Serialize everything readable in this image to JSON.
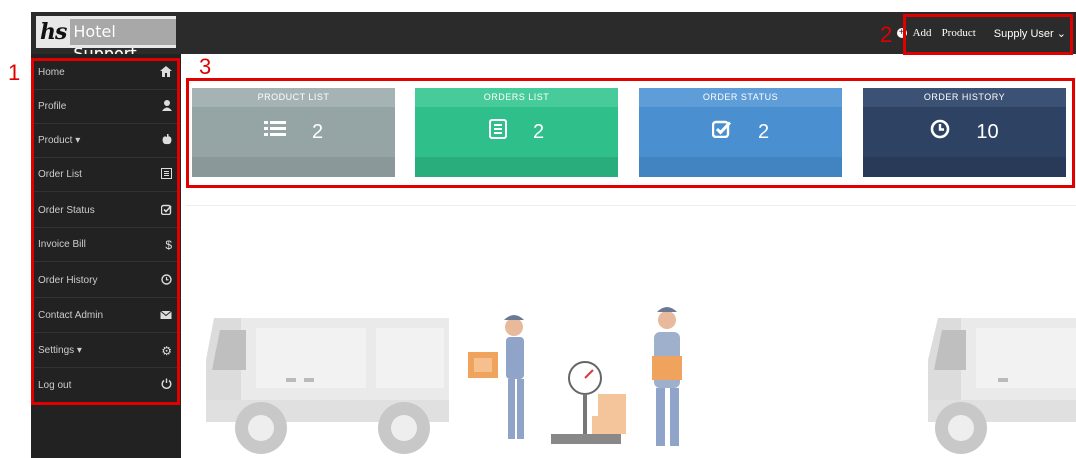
{
  "brand": {
    "logo_mark": "hs",
    "name": "Hotel Support"
  },
  "topnav": {
    "add_label": "Add",
    "product_label": "Product",
    "user_label": "Supply User",
    "user_caret": "⌄"
  },
  "sidebar": {
    "items": [
      {
        "label": "Home",
        "icon": "home-icon",
        "glyph": "🏠"
      },
      {
        "label": "Profile",
        "icon": "user-icon",
        "glyph": "👤"
      },
      {
        "label": "Product",
        "icon": "apple-icon",
        "glyph": "🍎",
        "dropdown": true
      },
      {
        "label": "Order List",
        "icon": "list-icon",
        "glyph": "▤"
      },
      {
        "label": "Order Status",
        "icon": "check-square-icon",
        "glyph": "☑"
      },
      {
        "label": "Invoice Bill",
        "icon": "dollar-icon",
        "glyph": "$"
      },
      {
        "label": "Order History",
        "icon": "clock-icon",
        "glyph": "◷"
      },
      {
        "label": "Contact Admin",
        "icon": "envelope-icon",
        "glyph": "✉"
      },
      {
        "label": "Settings",
        "icon": "gear-icon",
        "glyph": "⚙",
        "dropdown": true
      },
      {
        "label": "Log out",
        "icon": "power-icon",
        "glyph": "⏻"
      }
    ]
  },
  "cards": [
    {
      "title": "PRODUCT LIST",
      "value": "2",
      "icon": "list-icon",
      "color": "#95a5a6"
    },
    {
      "title": "ORDERS LIST",
      "value": "2",
      "icon": "document-icon",
      "color": "#2fbf8a"
    },
    {
      "title": "ORDER STATUS",
      "value": "2",
      "icon": "check-square-icon",
      "color": "#4a8fd0"
    },
    {
      "title": "ORDER HISTORY",
      "value": "10",
      "icon": "clock-icon",
      "color": "#2e4363"
    }
  ],
  "annotations": {
    "n1": "1",
    "n2": "2",
    "n3": "3"
  },
  "colors": {
    "annotation": "#e00000",
    "sidebar": "#222222",
    "topbar": "#2b2b2b"
  }
}
